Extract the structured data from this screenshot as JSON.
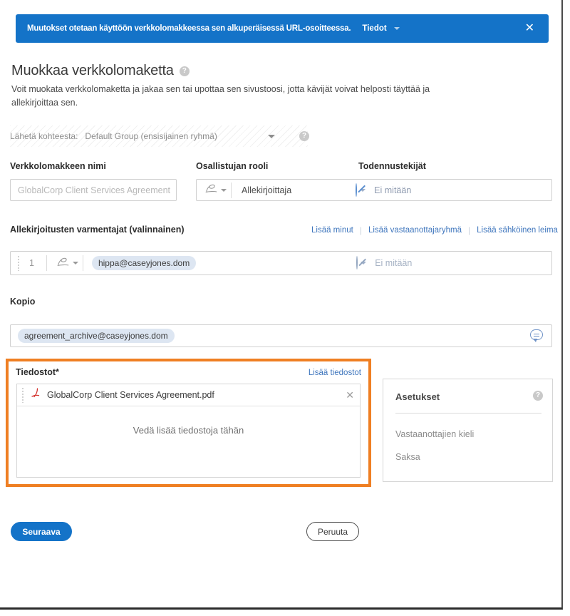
{
  "banner": {
    "message": "Muutokset otetaan käyttöön verkkolomakkeessa sen alkuperäisessä URL-osoitteessa.",
    "link_label": "Tiedot",
    "close_label": "✕",
    "background_color": "#1473c8"
  },
  "header": {
    "title": "Muokkaa verkkolomaketta",
    "help_icon_label": "?",
    "description": "Voit muokata verkkolomaketta ja jakaa sen tai upottaa sen sivustoosi, jotta kävijät voivat helposti täyttää ja allekirjoittaa sen."
  },
  "send_from": {
    "label": "Lähetä kohteesta:",
    "value": "Default Group (ensisijainen ryhmä)",
    "help_icon_label": "?"
  },
  "form_name": {
    "label": "Verkkolomakkeen nimi",
    "placeholder": "GlobalCorp Client Services Agreement",
    "value": ""
  },
  "participant_role": {
    "label": "Osallistujan rooli",
    "value": "Allekirjoittaja"
  },
  "auth_factors": {
    "label": "Todennustekijät",
    "value": "Ei mitään"
  },
  "verifiers": {
    "label": "Allekirjoitusten varmentajat (valinnainen)",
    "links": [
      "Lisää minut",
      "Lisää vastaanottajaryhmä",
      "Lisää sähköinen leima"
    ],
    "row": {
      "index": "1",
      "email": "hippa@caseyjones.dom",
      "auth_value": "Ei mitään"
    }
  },
  "cc": {
    "label": "Kopio",
    "email": "agreement_archive@caseyjones.dom"
  },
  "files": {
    "label": "Tiedostot*",
    "add_link": "Lisää tiedostot",
    "items": [
      {
        "name": "GlobalCorp Client Services Agreement.pdf",
        "remove_label": "✕"
      }
    ],
    "drop_text": "Vedä lisää tiedostoja tähän",
    "highlight_color": "#ef7f23"
  },
  "settings": {
    "title": "Asetukset",
    "help_icon_label": "?",
    "language_label": "Vastaanottajien kieli",
    "language_value": "Saksa"
  },
  "footer": {
    "next_label": "Seuraava",
    "cancel_label": "Peruuta"
  }
}
